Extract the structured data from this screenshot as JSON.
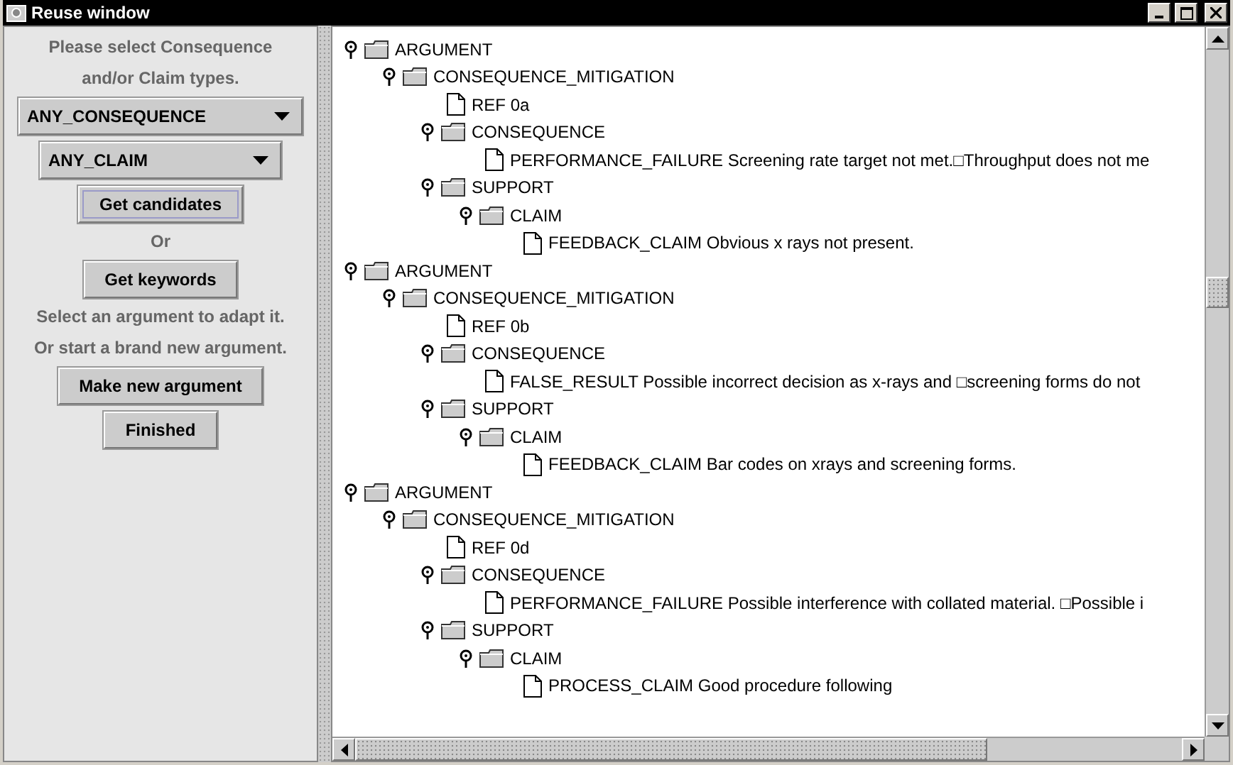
{
  "window": {
    "title": "Reuse window"
  },
  "left_panel": {
    "items": [
      {
        "kind": "label",
        "text": "Please select Consequence"
      },
      {
        "kind": "label",
        "text": "and/or Claim types."
      },
      {
        "kind": "dropdown",
        "value": "ANY_CONSEQUENCE",
        "wide": true
      },
      {
        "kind": "dropdown",
        "value": "ANY_CLAIM",
        "wide": false
      },
      {
        "kind": "button",
        "text": "Get candidates",
        "focused": true
      },
      {
        "kind": "label",
        "text": "Or"
      },
      {
        "kind": "button",
        "text": "Get keywords",
        "focused": false
      },
      {
        "kind": "label",
        "text": "Select an argument to adapt it."
      },
      {
        "kind": "label",
        "text": "Or start a brand new argument."
      },
      {
        "kind": "button",
        "text": "Make new argument",
        "focused": false
      },
      {
        "kind": "button",
        "text": "Finished",
        "focused": false
      }
    ]
  },
  "tree": [
    {
      "kind": "folder",
      "label": "ARGUMENT",
      "expanded": true,
      "children": [
        {
          "kind": "folder",
          "label": "CONSEQUENCE_MITIGATION",
          "expanded": true,
          "children": [
            {
              "kind": "leaf",
              "label": "REF 0a"
            },
            {
              "kind": "folder",
              "label": "CONSEQUENCE",
              "expanded": true,
              "children": [
                {
                  "kind": "leaf",
                  "label": "PERFORMANCE_FAILURE Screening rate target not met.□Throughput does not me"
                }
              ]
            },
            {
              "kind": "folder",
              "label": "SUPPORT",
              "expanded": true,
              "children": [
                {
                  "kind": "folder",
                  "label": "CLAIM",
                  "expanded": true,
                  "children": [
                    {
                      "kind": "leaf",
                      "label": "FEEDBACK_CLAIM Obvious x rays not present."
                    }
                  ]
                }
              ]
            }
          ]
        }
      ]
    },
    {
      "kind": "folder",
      "label": "ARGUMENT",
      "expanded": true,
      "children": [
        {
          "kind": "folder",
          "label": "CONSEQUENCE_MITIGATION",
          "expanded": true,
          "children": [
            {
              "kind": "leaf",
              "label": "REF 0b"
            },
            {
              "kind": "folder",
              "label": "CONSEQUENCE",
              "expanded": true,
              "children": [
                {
                  "kind": "leaf",
                  "label": "FALSE_RESULT Possible incorrect decision as x-rays and □screening forms do not"
                }
              ]
            },
            {
              "kind": "folder",
              "label": "SUPPORT",
              "expanded": true,
              "children": [
                {
                  "kind": "folder",
                  "label": "CLAIM",
                  "expanded": true,
                  "children": [
                    {
                      "kind": "leaf",
                      "label": "FEEDBACK_CLAIM Bar codes on xrays and screening forms."
                    }
                  ]
                }
              ]
            }
          ]
        }
      ]
    },
    {
      "kind": "folder",
      "label": "ARGUMENT",
      "expanded": true,
      "children": [
        {
          "kind": "folder",
          "label": "CONSEQUENCE_MITIGATION",
          "expanded": true,
          "children": [
            {
              "kind": "leaf",
              "label": "REF 0d"
            },
            {
              "kind": "folder",
              "label": "CONSEQUENCE",
              "expanded": true,
              "children": [
                {
                  "kind": "leaf",
                  "label": "PERFORMANCE_FAILURE Possible interference with collated material. □Possible i"
                }
              ]
            },
            {
              "kind": "folder",
              "label": "SUPPORT",
              "expanded": true,
              "children": [
                {
                  "kind": "folder",
                  "label": "CLAIM",
                  "expanded": true,
                  "children": [
                    {
                      "kind": "leaf",
                      "label": "PROCESS_CLAIM Good procedure following"
                    }
                  ]
                }
              ]
            }
          ]
        }
      ]
    }
  ]
}
